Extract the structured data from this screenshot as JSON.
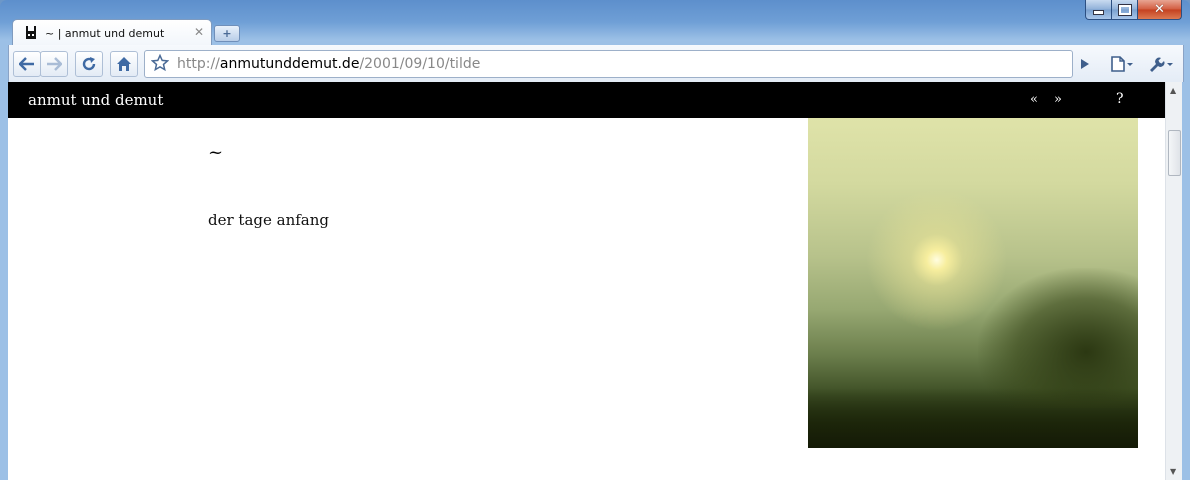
{
  "browser": {
    "tab_title": "~ | anmut und demut",
    "url_scheme": "http://",
    "url_host": "anmutunddemut.de",
    "url_path": "/2001/09/10/tilde"
  },
  "site": {
    "title": "anmut und demut",
    "nav_prev": "«",
    "nav_next": "»",
    "nav_help": "?"
  },
  "post": {
    "title": "~",
    "text": "der tage anfang"
  },
  "icons": {
    "back": "back-arrow-icon",
    "forward": "forward-arrow-icon",
    "reload": "reload-icon",
    "home": "home-icon",
    "bookmark": "star-icon",
    "go": "play-icon",
    "page_menu": "page-icon",
    "wrench_menu": "wrench-icon"
  }
}
